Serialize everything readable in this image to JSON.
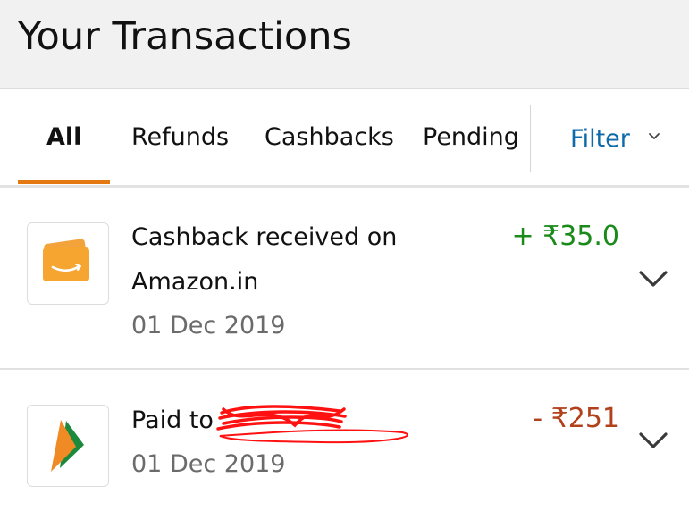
{
  "header": {
    "title": "Your Transactions"
  },
  "tabs": [
    {
      "label": "All",
      "active": true
    },
    {
      "label": "Refunds",
      "active": false
    },
    {
      "label": "Cashbacks",
      "active": false
    },
    {
      "label": "Pending",
      "active": false
    }
  ],
  "filter": {
    "label": "Filter",
    "icon": "chevron-down-icon"
  },
  "transactions": [
    {
      "icon": "amazon-card-icon",
      "description_line1": "Cashback received on",
      "description_line2": "Amazon.in",
      "date": "01 Dec 2019",
      "amount": "+ ₹35.0",
      "amount_color": "#1a8a1a"
    },
    {
      "icon": "bhim-upi-icon",
      "description_prefix": "Paid to",
      "description_redacted": true,
      "date": "01 Dec 2019",
      "amount": "- ₹251",
      "amount_color": "#b1401b"
    }
  ],
  "colors": {
    "accent": "#e47911",
    "link": "#0f6aa9",
    "redaction": "#ff0000"
  }
}
